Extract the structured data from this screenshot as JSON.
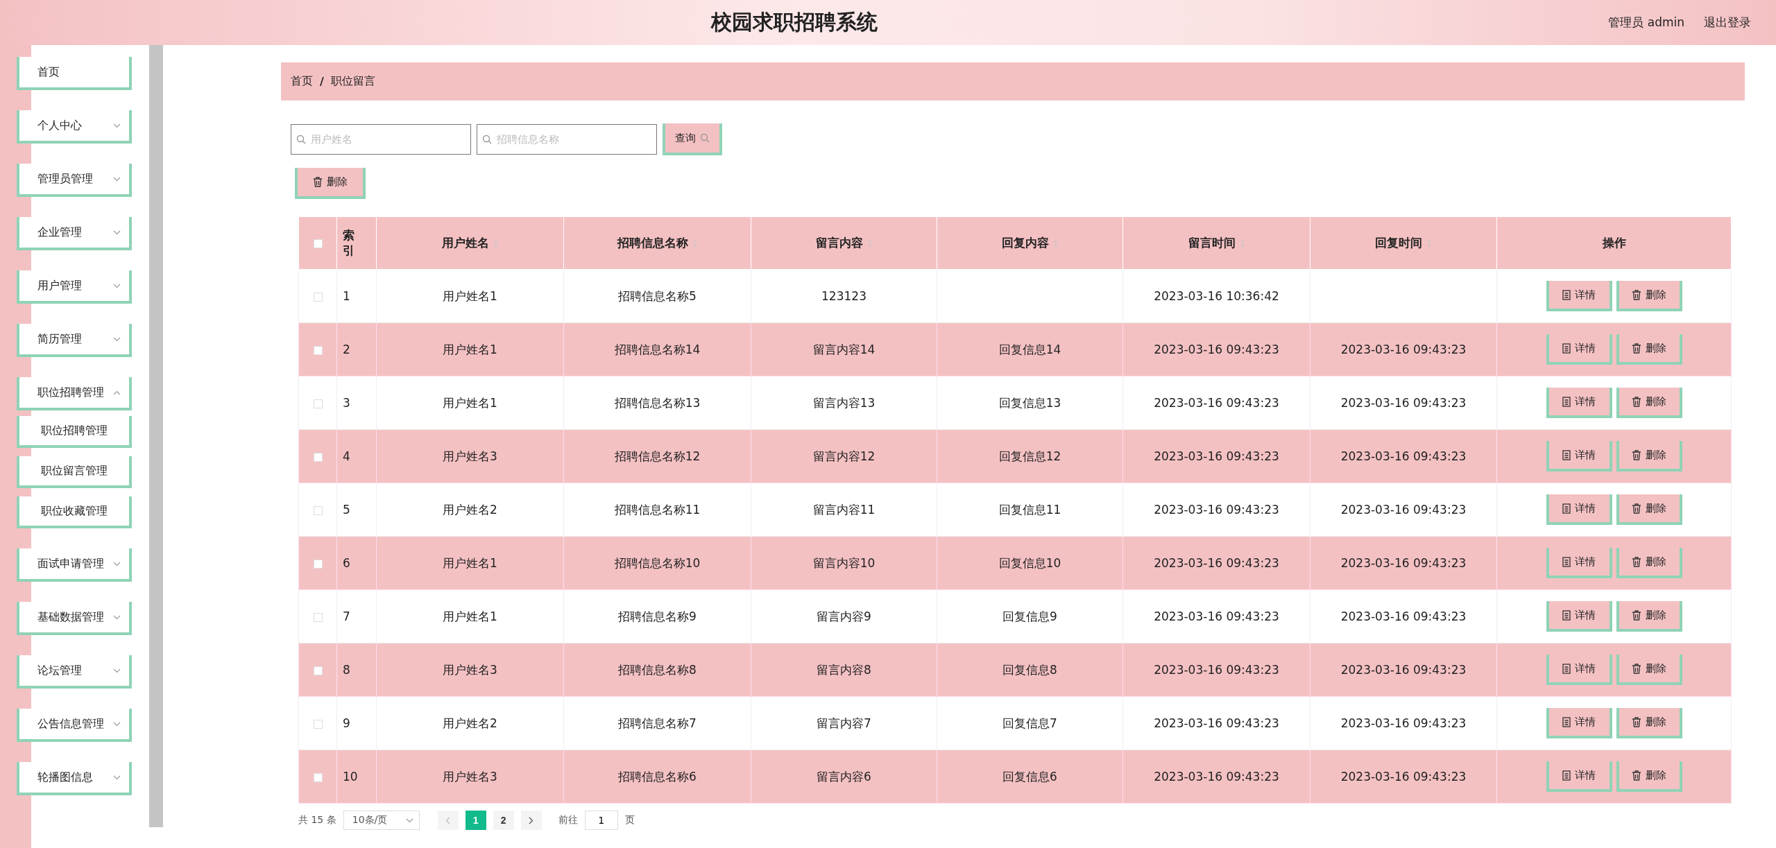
{
  "header": {
    "title": "校园求职招聘系统",
    "user": "管理员 admin",
    "logout": "退出登录"
  },
  "sidebar": {
    "items": [
      {
        "label": "首页",
        "kind": "link"
      },
      {
        "label": "个人中心",
        "kind": "menu",
        "expanded": false
      },
      {
        "label": "管理员管理",
        "kind": "menu",
        "expanded": false
      },
      {
        "label": "企业管理",
        "kind": "menu",
        "expanded": false
      },
      {
        "label": "用户管理",
        "kind": "menu",
        "expanded": false
      },
      {
        "label": "简历管理",
        "kind": "menu",
        "expanded": false
      },
      {
        "label": "职位招聘管理",
        "kind": "menu",
        "expanded": true,
        "children": [
          {
            "label": "职位招聘管理"
          },
          {
            "label": "职位留言管理"
          },
          {
            "label": "职位收藏管理"
          }
        ]
      },
      {
        "label": "面试申请管理",
        "kind": "menu",
        "expanded": false
      },
      {
        "label": "基础数据管理",
        "kind": "menu",
        "expanded": false
      },
      {
        "label": "论坛管理",
        "kind": "menu",
        "expanded": false
      },
      {
        "label": "公告信息管理",
        "kind": "menu",
        "expanded": false
      },
      {
        "label": "轮播图信息",
        "kind": "menu",
        "expanded": false
      }
    ]
  },
  "breadcrumb": {
    "items": [
      "首页",
      "职位留言"
    ],
    "separator": "/"
  },
  "search": {
    "fields": [
      {
        "placeholder": "用户姓名"
      },
      {
        "placeholder": "招聘信息名称"
      }
    ],
    "button": "查询"
  },
  "toolbar": {
    "delete": "删除"
  },
  "table": {
    "header_checkbox": {
      "checked": false
    },
    "columns": [
      {
        "label": "索引",
        "sortable": false
      },
      {
        "label": "用户姓名",
        "sortable": true
      },
      {
        "label": "招聘信息名称",
        "sortable": true
      },
      {
        "label": "留言内容",
        "sortable": true
      },
      {
        "label": "回复内容",
        "sortable": true
      },
      {
        "label": "留言时间",
        "sortable": true
      },
      {
        "label": "回复时间",
        "sortable": true
      },
      {
        "label": "操作",
        "sortable": false
      }
    ],
    "rows": [
      {
        "checked": false,
        "index": "1",
        "user": "用户姓名1",
        "job": "招聘信息名称5",
        "message": "123123",
        "time": "2023-03-16 10:36:42",
        "actions": [
          "详情",
          "删除"
        ]
      },
      {
        "checked": false,
        "index": "2",
        "user": "用户姓名1",
        "job": "招聘信息名称14",
        "message": "留言内容14",
        "reply": "回复信息14",
        "time": "2023-03-16 09:43:23",
        "reply_time": "2023-03-16 09:43:23",
        "actions": [
          "详情",
          "删除"
        ]
      },
      {
        "checked": false,
        "index": "3",
        "user": "用户姓名1",
        "job": "招聘信息名称13",
        "message": "留言内容13",
        "reply": "回复信息13",
        "time": "2023-03-16 09:43:23",
        "reply_time": "2023-03-16 09:43:23",
        "actions": [
          "详情",
          "删除"
        ]
      },
      {
        "checked": false,
        "index": "4",
        "user": "用户姓名3",
        "job": "招聘信息名称12",
        "message": "留言内容12",
        "reply": "回复信息12",
        "time": "2023-03-16 09:43:23",
        "reply_time": "2023-03-16 09:43:23",
        "actions": [
          "详情",
          "删除"
        ]
      },
      {
        "checked": false,
        "index": "5",
        "user": "用户姓名2",
        "job": "招聘信息名称11",
        "message": "留言内容11",
        "reply": "回复信息11",
        "time": "2023-03-16 09:43:23",
        "reply_time": "2023-03-16 09:43:23",
        "actions": [
          "详情",
          "删除"
        ]
      },
      {
        "checked": false,
        "index": "6",
        "user": "用户姓名1",
        "job": "招聘信息名称10",
        "message": "留言内容10",
        "reply": "回复信息10",
        "time": "2023-03-16 09:43:23",
        "reply_time": "2023-03-16 09:43:23",
        "actions": [
          "详情",
          "删除"
        ]
      },
      {
        "checked": false,
        "index": "7",
        "user": "用户姓名1",
        "job": "招聘信息名称9",
        "message": "留言内容9",
        "reply": "回复信息9",
        "time": "2023-03-16 09:43:23",
        "reply_time": "2023-03-16 09:43:23",
        "actions": [
          "详情",
          "删除"
        ]
      },
      {
        "checked": false,
        "index": "8",
        "user": "用户姓名3",
        "job": "招聘信息名称8",
        "message": "留言内容8",
        "reply": "回复信息8",
        "time": "2023-03-16 09:43:23",
        "reply_time": "2023-03-16 09:43:23",
        "actions": [
          "详情",
          "删除"
        ]
      },
      {
        "checked": false,
        "index": "9",
        "user": "用户姓名2",
        "job": "招聘信息名称7",
        "message": "留言内容7",
        "reply": "回复信息7",
        "time": "2023-03-16 09:43:23",
        "reply_time": "2023-03-16 09:43:23",
        "actions": [
          "详情",
          "删除"
        ]
      },
      {
        "checked": false,
        "index": "10",
        "user": "用户姓名3",
        "job": "招聘信息名称6",
        "message": "留言内容6",
        "reply": "回复信息6",
        "time": "2023-03-16 09:43:23",
        "reply_time": "2023-03-16 09:43:23",
        "actions": [
          "详情",
          "删除"
        ]
      }
    ]
  },
  "pagination": {
    "total": "共 15 条",
    "page_size": "10条/页",
    "pages": [
      {
        "label": "1",
        "selected": true
      },
      {
        "label": "2",
        "selected": false
      }
    ],
    "goto_label": "前往",
    "goto_value": "1",
    "goto_suffix": "页"
  }
}
